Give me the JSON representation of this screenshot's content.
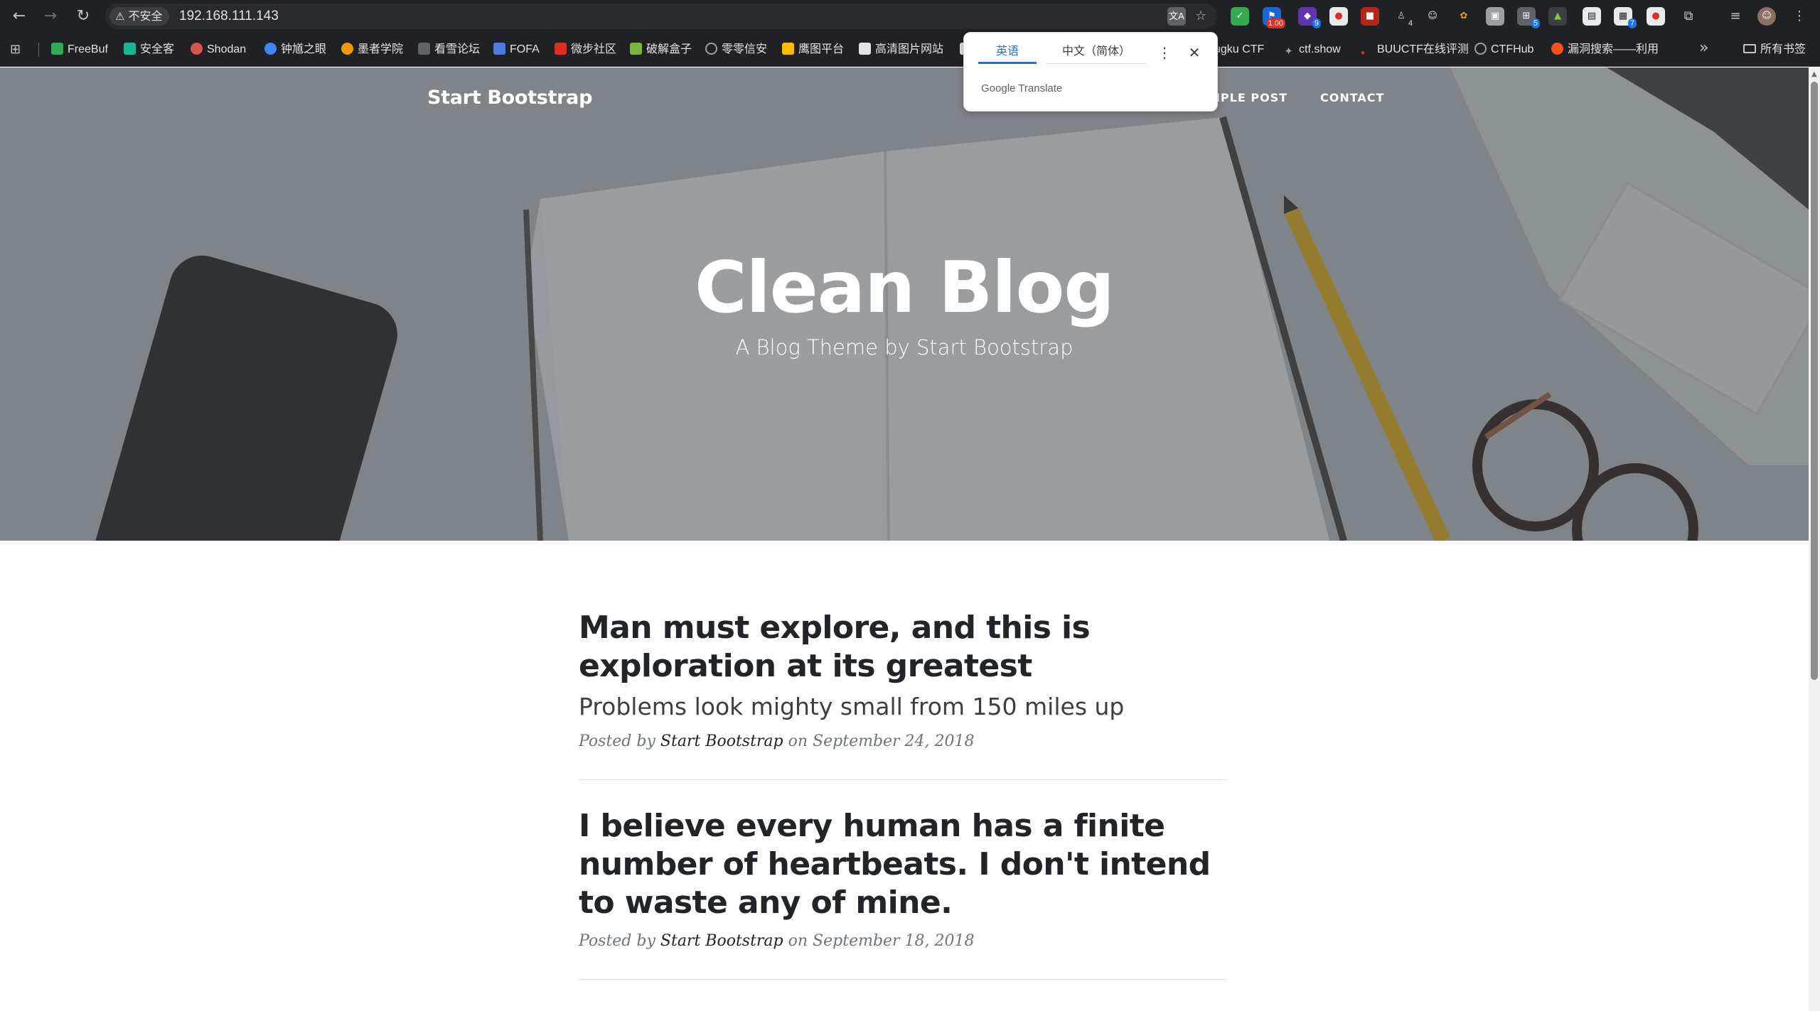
{
  "browser": {
    "security_label": "不安全",
    "url": "192.168.111.143",
    "translate_icon": "translate-icon",
    "bookmark_icon": "star-icon",
    "extension_badges": [
      "1.00",
      "9",
      "4",
      "5",
      "7"
    ]
  },
  "bookmarks": [
    {
      "label": "FreeBuf",
      "color": "#34a853"
    },
    {
      "label": "安全客",
      "color": "#1ab394"
    },
    {
      "label": "Shodan",
      "color": "#d9534f"
    },
    {
      "label": "钟馗之眼",
      "color": "#4285f4"
    },
    {
      "label": "墨者学院",
      "color": "#f29900"
    },
    {
      "label": "看雪论坛",
      "color": "#5f6368"
    },
    {
      "label": "FOFA",
      "color": "#4f7bd9"
    },
    {
      "label": "微步社区",
      "color": "#d93025"
    },
    {
      "label": "破解盒子",
      "color": "#7cb342"
    },
    {
      "label": "零零信安",
      "color": "#202124"
    },
    {
      "label": "鹰图平台",
      "color": "#fbbc04"
    },
    {
      "label": "高清图片网站",
      "color": "#e3e3e3"
    },
    {
      "label": "ugku CTF",
      "color": ""
    },
    {
      "label": "ctf.show",
      "color": "#9aa0a6"
    },
    {
      "label": "BUUCTF在线评测",
      "color": "#d93025"
    },
    {
      "label": "CTFHub",
      "color": "#9aa0a6"
    },
    {
      "label": "漏洞搜索——利用",
      "color": "#f4511e"
    }
  ],
  "bookmarks_folder": "所有书签",
  "translate_popup": {
    "tab_source": "英语",
    "tab_target": "中文（简体）",
    "brand": "Google",
    "product": "Translate"
  },
  "site": {
    "brand": "Start Bootstrap",
    "nav": [
      "SAMPLE POST",
      "CONTACT"
    ],
    "nav_visible_fragment": "MPLE POST"
  },
  "hero": {
    "title": "Clean Blog",
    "subtitle": "A Blog Theme by Start Bootstrap"
  },
  "posts": [
    {
      "title": "Man must explore, and this is exploration at its greatest",
      "subtitle": "Problems look mighty small from 150 miles up",
      "meta_prefix": "Posted by",
      "author": "Start Bootstrap",
      "meta_on": "on September 24, 2018"
    },
    {
      "title": "I believe every human has a finite number of heartbeats. I don't intend to waste any of mine.",
      "subtitle": "",
      "meta_prefix": "Posted by",
      "author": "Start Bootstrap",
      "meta_on": "on September 18, 2018"
    }
  ],
  "colors": {
    "chrome_dark": "#202124",
    "link_blue": "#1a73e8",
    "text_dark": "#212529",
    "meta_gray": "#6c757d"
  }
}
